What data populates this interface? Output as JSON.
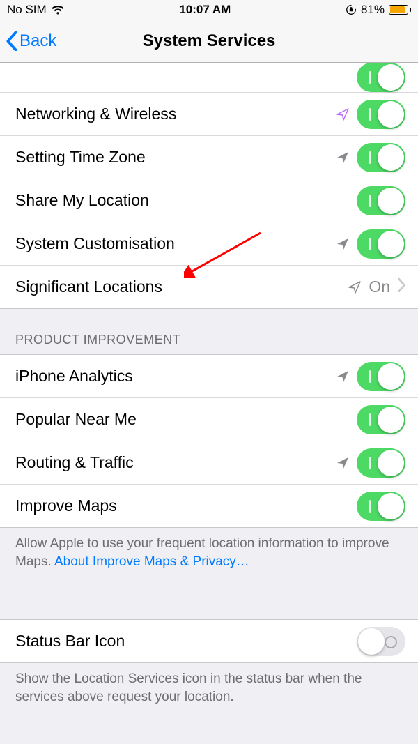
{
  "status": {
    "carrier": "No SIM",
    "time": "10:07 AM",
    "battery_percent": "81%"
  },
  "nav": {
    "back_label": "Back",
    "title": "System Services"
  },
  "section1": {
    "rows": [
      {
        "label": "Networking & Wireless",
        "arrow": "purple-outline",
        "toggle": true
      },
      {
        "label": "Setting Time Zone",
        "arrow": "grey-solid",
        "toggle": true
      },
      {
        "label": "Share My Location",
        "arrow": "none",
        "toggle": true
      },
      {
        "label": "System Customisation",
        "arrow": "grey-solid",
        "toggle": true
      }
    ],
    "nav_row": {
      "label": "Significant Locations",
      "arrow": "grey-outline",
      "value": "On"
    }
  },
  "section2": {
    "header": "Product Improvement",
    "rows": [
      {
        "label": "iPhone Analytics",
        "arrow": "grey-solid",
        "toggle": true
      },
      {
        "label": "Popular Near Me",
        "arrow": "none",
        "toggle": true
      },
      {
        "label": "Routing & Traffic",
        "arrow": "grey-solid",
        "toggle": true
      },
      {
        "label": "Improve Maps",
        "arrow": "none",
        "toggle": true
      }
    ],
    "footer_text": "Allow Apple to use your frequent location information to improve Maps. ",
    "footer_link": "About Improve Maps & Privacy…"
  },
  "section3": {
    "row": {
      "label": "Status Bar Icon",
      "toggle": false
    },
    "footer_text": "Show the Location Services icon in the status bar when the services above request your location."
  }
}
